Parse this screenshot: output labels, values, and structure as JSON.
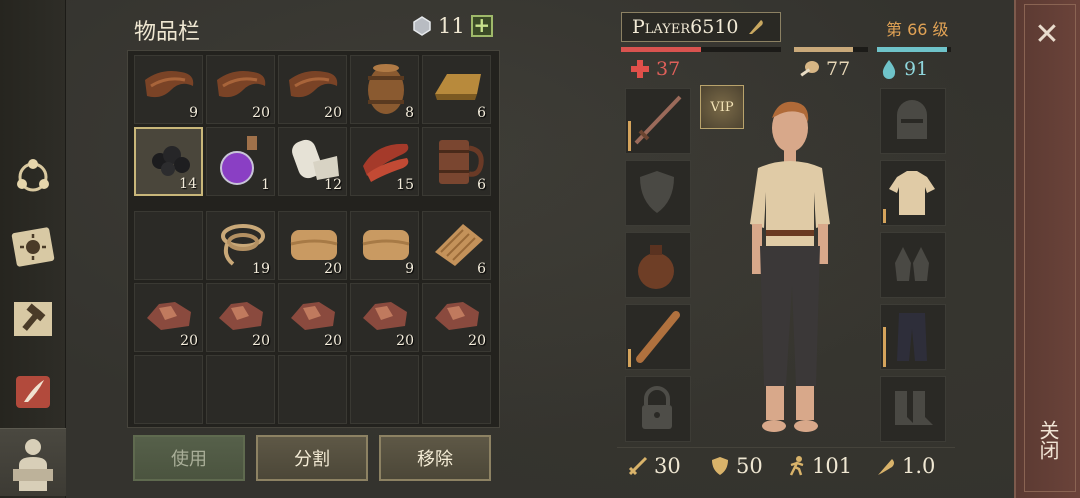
{
  "inventory": {
    "title": "物品栏",
    "slot_count": "11",
    "add_label": "+",
    "items": [
      {
        "name": "leather-icon",
        "count": "9"
      },
      {
        "name": "leather-icon",
        "count": "20"
      },
      {
        "name": "leather-icon",
        "count": "20"
      },
      {
        "name": "barrel-icon",
        "count": "8"
      },
      {
        "name": "bronze-ingot-icon",
        "count": "6"
      },
      {
        "name": "coal-icon",
        "count": "14"
      },
      {
        "name": "potion-icon",
        "count": "1"
      },
      {
        "name": "cloth-roll-icon",
        "count": "12"
      },
      {
        "name": "raw-meat-icon",
        "count": "15"
      },
      {
        "name": "wooden-mug-icon",
        "count": "6"
      },
      {
        "name": "empty",
        "count": ""
      },
      {
        "name": "rope-icon",
        "count": "19"
      },
      {
        "name": "folded-cloth-icon",
        "count": "20"
      },
      {
        "name": "folded-cloth-icon",
        "count": "9"
      },
      {
        "name": "rug-icon",
        "count": "6"
      },
      {
        "name": "copper-ore-icon",
        "count": "20"
      },
      {
        "name": "copper-ore-icon",
        "count": "20"
      },
      {
        "name": "copper-ore-icon",
        "count": "20"
      },
      {
        "name": "copper-ore-icon",
        "count": "20"
      },
      {
        "name": "copper-ore-icon",
        "count": "20"
      }
    ],
    "buttons": {
      "use": "使用",
      "split": "分割",
      "remove": "移除"
    }
  },
  "character": {
    "name": "Player6510",
    "level": "第 66 级",
    "health": "37",
    "hunger": "77",
    "thirst": "91",
    "health_fraction": 0.5,
    "hunger_fraction": 0.8,
    "thirst_fraction": 0.95,
    "vip_label": "VIP",
    "stats": {
      "attack": "30",
      "defense": "50",
      "speed": "101",
      "weight": "1.0"
    }
  },
  "close_label": "关闭",
  "colors": {
    "health": "#d9534f",
    "hunger": "#c9a97a",
    "thirst": "#6fc3c9",
    "accent": "#e2a355"
  }
}
